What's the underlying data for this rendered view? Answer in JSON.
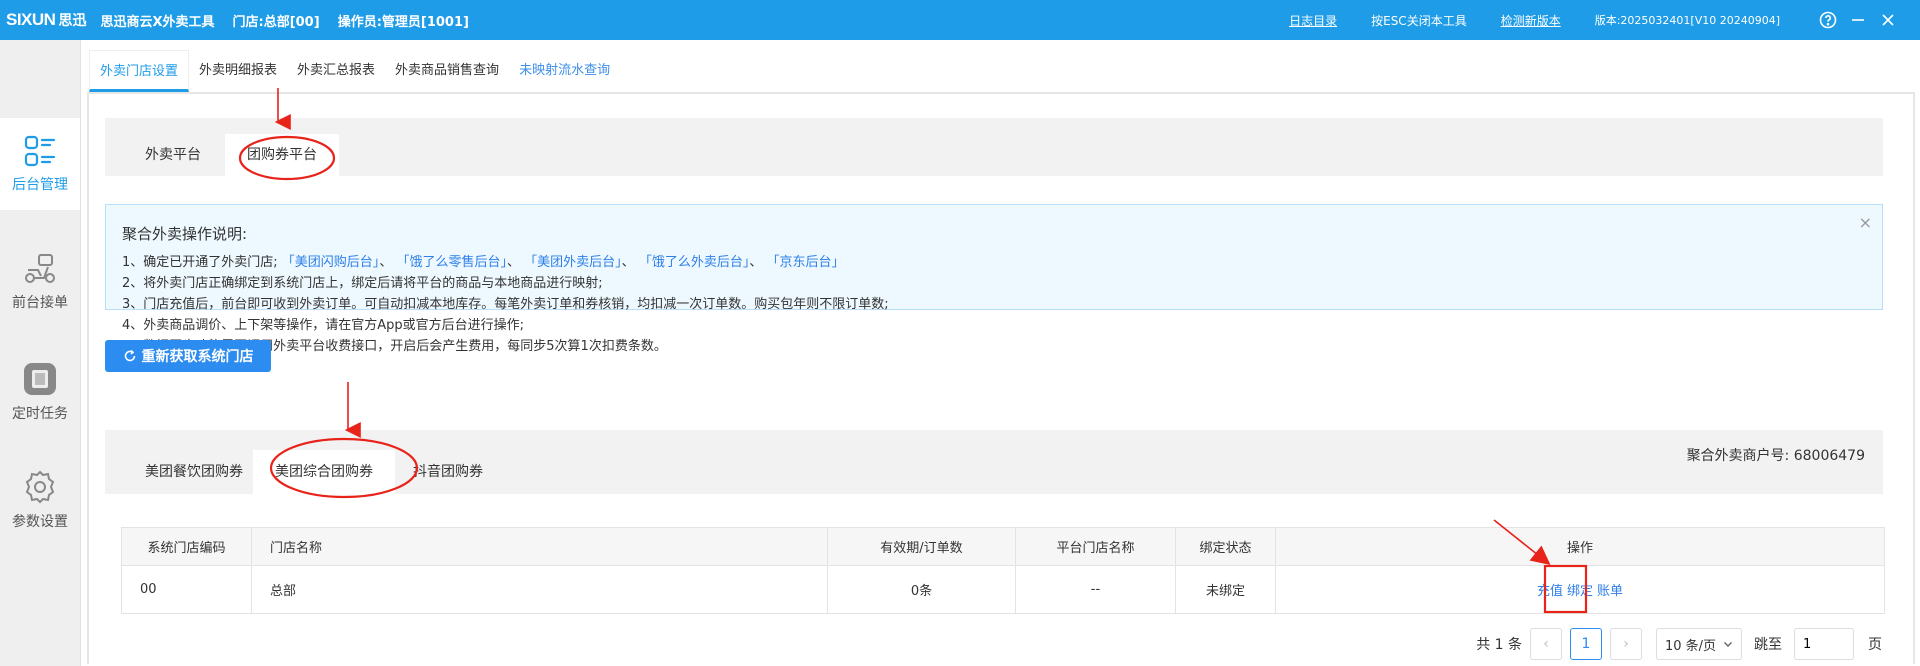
{
  "titlebar": {
    "logo": "SIXUN",
    "logo_cn": "思迅",
    "app_name": "思迅商云X外卖工具",
    "store": "门店:总部[00]",
    "operator": "操作员:管理员[1001]",
    "log_dir": "日志目录",
    "esc_hint": "按ESC关闭本工具",
    "check_update": "检测新版本",
    "version": "版本:2025032401[V10 20240904]"
  },
  "sidebar": {
    "items": [
      {
        "label": "后台管理",
        "icon": "list-grid-icon"
      },
      {
        "label": "前台接单",
        "icon": "scooter-icon"
      },
      {
        "label": "定时任务",
        "icon": "timer-icon"
      },
      {
        "label": "参数设置",
        "icon": "gear-icon"
      }
    ]
  },
  "top_tabs": [
    "外卖门店设置",
    "外卖明细报表",
    "外卖汇总报表",
    "外卖商品销售查询",
    "未映射流水查询"
  ],
  "platform_tabs": [
    "外卖平台",
    "团购券平台"
  ],
  "notice": {
    "title": "聚合外卖操作说明:",
    "line1_prefix": "1、确定已开通了外卖门店;",
    "line1_links": [
      "「美团闪购后台」",
      "「饿了么零售后台」",
      "「美团外卖后台」",
      "「饿了么外卖后台」",
      "「京东后台」"
    ],
    "sep": "、",
    "line2": "2、将外卖门店正确绑定到系统门店上，绑定后请将平台的商品与本地商品进行映射;",
    "line3": "3、门店充值后，前台即可收到外卖订单。可自动扣减本地库存。每笔外卖订单和券核销，均扣减一次订单数。购买包年则不限订单数;",
    "line4": "4、外卖商品调价、上下架等操作，请在官方App或官方后台进行操作;",
    "line5": "5、数据同步功能需要调用外卖平台收费接口，开启后会产生费用，每同步5次算1次扣费条数。",
    "close": "×"
  },
  "refresh_button": "重新获取系统门店",
  "coupon_tabs": [
    "美团餐饮团购券",
    "美团综合团购券",
    "抖音团购券"
  ],
  "merchant_label": "聚合外卖商户号: 68006479",
  "table": {
    "headers": [
      "系统门店编码",
      "门店名称",
      "有效期/订单数",
      "平台门店名称",
      "绑定状态",
      "操作"
    ],
    "rows": [
      {
        "code": "00",
        "name": "总部",
        "orders": "0条",
        "platform_store": "--",
        "status": "未绑定",
        "ops": [
          "充值",
          "绑定",
          "账单"
        ]
      }
    ]
  },
  "pager": {
    "total": "共 1 条",
    "prev": "‹",
    "current": "1",
    "next": "›",
    "page_size": "10 条/页",
    "jump_label": "跳至",
    "jump_value": "1",
    "page_suffix": "页"
  },
  "colors": {
    "primary": "#1e9ce8",
    "button": "#2d8cf0",
    "link": "#2d7fe8",
    "danger": "#e23b2e",
    "annotation": "#e8231a"
  }
}
